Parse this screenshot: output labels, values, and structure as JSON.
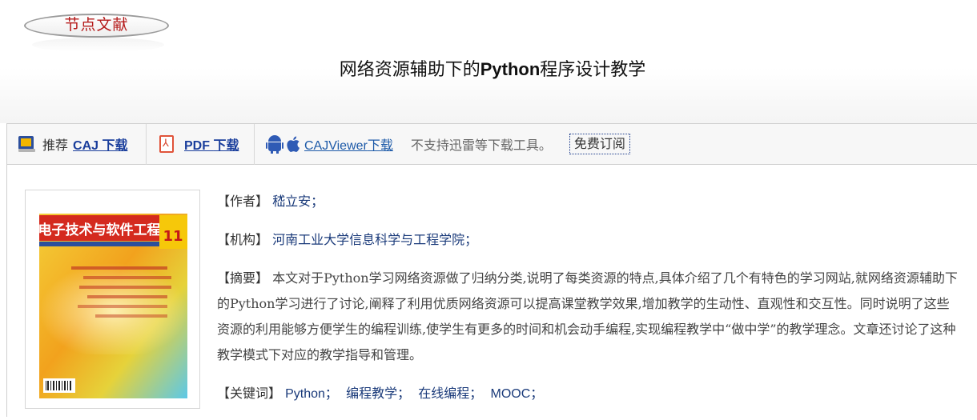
{
  "header": {
    "badge": "节点文献",
    "title_pre": "网络资源辅助下的",
    "title_bold": "Python",
    "title_post": "程序设计教学"
  },
  "toolbar": {
    "recommend": "推荐",
    "caj_en": "CAJ",
    "caj_cn": "下载",
    "pdf_en": "PDF",
    "pdf_cn": "下载",
    "viewer_en": "CAJViewer",
    "viewer_cn": "下载",
    "note": "不支持迅雷等下载工具。",
    "free_read": "免费订阅"
  },
  "cover": {
    "journal_name": "电子技术与软件工程",
    "issue_number": "11"
  },
  "article": {
    "author_label": "【作者】",
    "author": "嵇立安；",
    "org_label": "【机构】",
    "org": "河南工业大学信息科学与工程学院；",
    "abstract_label": "【摘要】",
    "abstract": "本文对于Python学习网络资源做了归纳分类,说明了每类资源的特点,具体介绍了几个有特色的学习网站,就网络资源辅助下的Python学习进行了讨论,阐释了利用优质网络资源可以提高课堂教学效果,增加教学的生动性、直观性和交互性。同时说明了这些资源的利用能够方便学生的编程训练,使学生有更多的时间和机会动手编程,实现编程教学中“做中学”的教学理念。文章还讨论了这种教学模式下对应的教学指导和管理。",
    "keywords_label": "【关键词】",
    "keywords": [
      "Python；",
      "编程教学；",
      "在线编程；",
      "MOOC；"
    ]
  },
  "colors": {
    "badge_red": "#b51a1a",
    "link_blue": "#1a3e9c",
    "value_blue": "#1a3a7a"
  }
}
